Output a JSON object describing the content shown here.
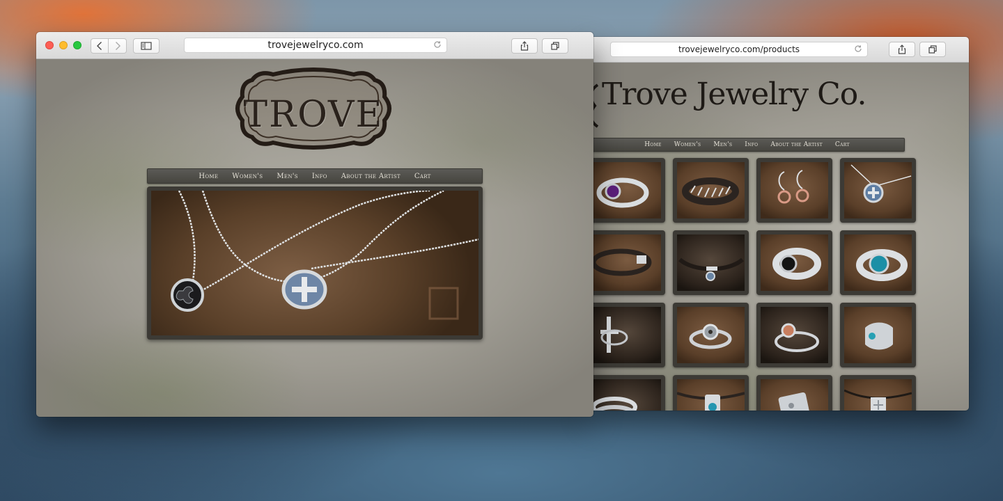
{
  "front_window": {
    "url": "trovejewelryco.com",
    "logo_text": "TROVE",
    "nav": [
      "Home",
      "Women's",
      "Men's",
      "Info",
      "About the Artist",
      "Cart"
    ]
  },
  "back_window": {
    "url": "trovejewelryco.com/products",
    "logo_text": "Trove Jewelry Co.",
    "nav": [
      "Home",
      "Women's",
      "Men's",
      "Info",
      "About the Artist",
      "Cart"
    ],
    "product_tiles": [
      {
        "name": "amethyst-ring"
      },
      {
        "name": "wrapped-cuff-ring"
      },
      {
        "name": "spiral-earrings"
      },
      {
        "name": "cross-pendant-necklace"
      },
      {
        "name": "leather-bracelet"
      },
      {
        "name": "cuff-bracelet-charm"
      },
      {
        "name": "onyx-ring"
      },
      {
        "name": "turquoise-ring"
      },
      {
        "name": "cross-ring"
      },
      {
        "name": "target-ring"
      },
      {
        "name": "copper-accent-ring"
      },
      {
        "name": "turquoise-wrap-ring"
      },
      {
        "name": "stacked-band-ring"
      },
      {
        "name": "turquoise-bar-pendant"
      },
      {
        "name": "square-pendant"
      },
      {
        "name": "tag-pendant-necklace"
      }
    ]
  }
}
